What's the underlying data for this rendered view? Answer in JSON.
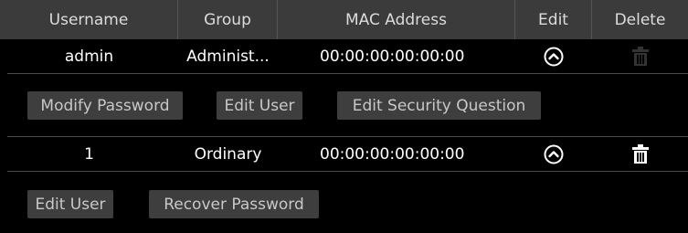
{
  "table": {
    "headers": {
      "username": "Username",
      "group": "Group",
      "mac": "MAC Address",
      "edit": "Edit",
      "delete": "Delete"
    },
    "rows": [
      {
        "username": "admin",
        "group": "Administ...",
        "mac": "00:00:00:00:00:00",
        "edit_icon": "chevron-up-circle-icon",
        "delete_icon": "trash-icon",
        "delete_enabled": false,
        "actions": [
          "Modify Password",
          "Edit User",
          "Edit Security Question"
        ]
      },
      {
        "username": "1",
        "group": "Ordinary",
        "mac": "00:00:00:00:00:00",
        "edit_icon": "chevron-up-circle-icon",
        "delete_icon": "trash-icon",
        "delete_enabled": true,
        "actions": [
          "Edit User",
          "Recover Password"
        ]
      }
    ]
  },
  "colors": {
    "background": "#000000",
    "header_bg": "#3b3b3b",
    "button_bg": "#3e3e3e",
    "button_text": "#c8c8c8",
    "text": "#ffffff",
    "disabled_icon": "#3a3a3a"
  }
}
